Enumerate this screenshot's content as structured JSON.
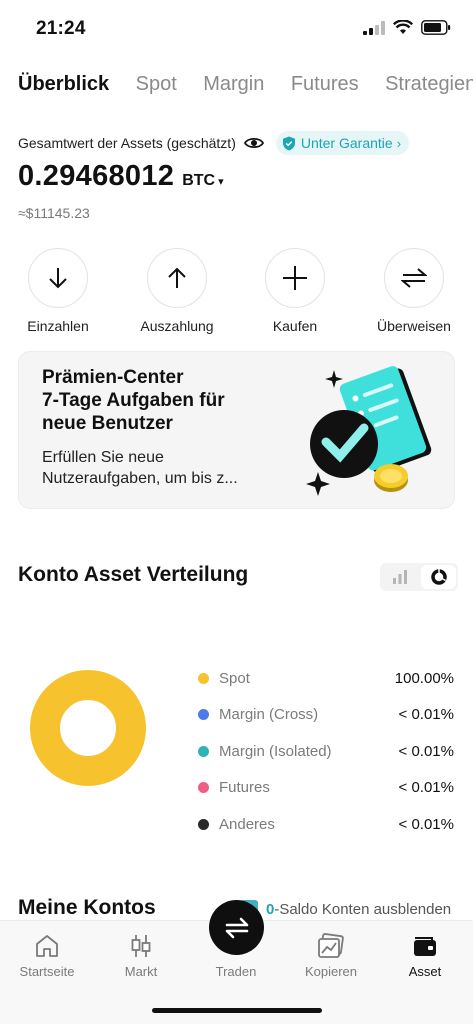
{
  "status": {
    "time": "21:24"
  },
  "tabs": [
    {
      "label": "Überblick",
      "active": true
    },
    {
      "label": "Spot",
      "active": false
    },
    {
      "label": "Margin",
      "active": false
    },
    {
      "label": "Futures",
      "active": false
    },
    {
      "label": "Strategien",
      "active": false
    }
  ],
  "overview": {
    "assets_label": "Gesamtwert der Assets (geschätzt)",
    "guarantee": "Unter Garantie",
    "guarantee_chevron": "›",
    "balance": "0.29468012",
    "unit": "BTC",
    "caret": "▾",
    "fiat": "≈$11145.23"
  },
  "actions": [
    {
      "label": "Einzahlen",
      "icon": "arrow-down-icon"
    },
    {
      "label": "Auszahlung",
      "icon": "arrow-up-icon"
    },
    {
      "label": "Kaufen",
      "icon": "plus-icon"
    },
    {
      "label": "Überweisen",
      "icon": "transfer-icon"
    }
  ],
  "promo": {
    "title_line1": "Prämien-Center",
    "title_line2": "7-Tage Aufgaben für",
    "title_line3": "neue Benutzer",
    "desc_line1": "Erfüllen Sie neue",
    "desc_line2": "Nutzeraufgaben, um bis z..."
  },
  "distribution": {
    "title": "Konto Asset Verteilung",
    "items": [
      {
        "label": "Spot",
        "value": "100.00%",
        "color": "#f6c22e",
        "share": 1.0
      },
      {
        "label": "Margin (Cross)",
        "value": "< 0.01%",
        "color": "#4a7be8",
        "share": 0
      },
      {
        "label": "Margin (Isolated)",
        "value": "< 0.01%",
        "color": "#2fb3b8",
        "share": 0
      },
      {
        "label": "Futures",
        "value": "< 0.01%",
        "color": "#ee5f86",
        "share": 0
      },
      {
        "label": "Anderes",
        "value": "< 0.01%",
        "color": "#2a2a2a",
        "share": 0
      }
    ]
  },
  "accounts": {
    "title": "Meine Kontos",
    "zero_count": "0",
    "zero_label": "-Saldo Konten ausblenden"
  },
  "nav": [
    {
      "label": "Startseite",
      "icon": "home-icon",
      "active": false
    },
    {
      "label": "Markt",
      "icon": "candlestick-icon",
      "active": false
    },
    {
      "label": "Traden",
      "icon": "swap-icon",
      "active": false
    },
    {
      "label": "Kopieren",
      "icon": "copy-chart-icon",
      "active": false
    },
    {
      "label": "Asset",
      "icon": "wallet-icon",
      "active": true
    }
  ],
  "colors": {
    "accent": "#1ba6b4",
    "donut": "#f6c22e"
  }
}
